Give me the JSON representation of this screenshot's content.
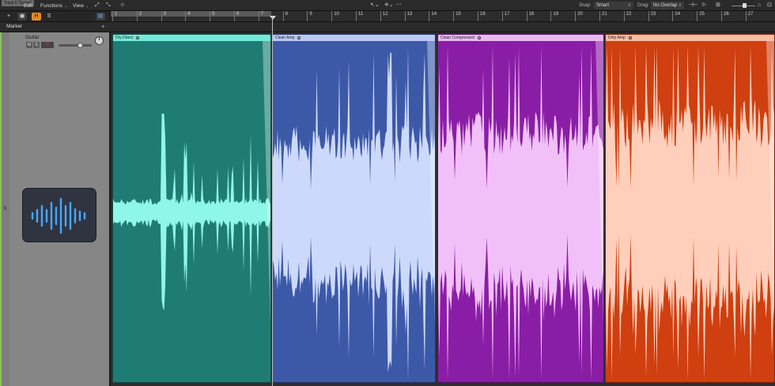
{
  "window": {
    "tooltip": "Track 5 \"Guitar\""
  },
  "menu": {
    "edit": "Edit",
    "functions": "Functions",
    "view": "View"
  },
  "toolbar": {
    "snap_label": "Snap:",
    "snap_value": "Smart",
    "drag_label": "Drag:",
    "drag_value": "No Overlap"
  },
  "track_list_header": {
    "add": "+",
    "h": "H",
    "s": "S"
  },
  "ruler": {
    "bars": [
      "1",
      "2",
      "3",
      "4",
      "5",
      "6",
      "7",
      "8",
      "9",
      "10",
      "11",
      "12",
      "13",
      "14",
      "15",
      "16",
      "17",
      "18",
      "19",
      "20",
      "21",
      "22",
      "23",
      "24",
      "25",
      "26",
      "27"
    ]
  },
  "marker": {
    "label": "Marker",
    "add": "+"
  },
  "track": {
    "number": "5",
    "name": "Guitar",
    "mute": "M",
    "solo": "S",
    "rec": "R",
    "volume_fraction": 0.7
  },
  "regions": [
    {
      "name": "Dry Direct",
      "color": "#1f7c74",
      "head_color": "#73ead9",
      "wave_color": "#8ff7e9"
    },
    {
      "name": "Clean Amp",
      "color": "#3c59a8",
      "head_color": "#b9c8f4",
      "wave_color": "#cdd9fb"
    },
    {
      "name": "Clean Compressed",
      "color": "#8a1da5",
      "head_color": "#eab8f2",
      "wave_color": "#f1c0f8"
    },
    {
      "name": "Dirty Amp",
      "color": "#cf3f10",
      "head_color": "#f7bca2",
      "wave_color": "#ffcfbb"
    }
  ],
  "icons": [
    "add-icon",
    "region-icon",
    "catch-icon",
    "pointer-tool-icon",
    "crosshair-tool-icon",
    "audio-waveform-icon",
    "zoom-icon"
  ]
}
